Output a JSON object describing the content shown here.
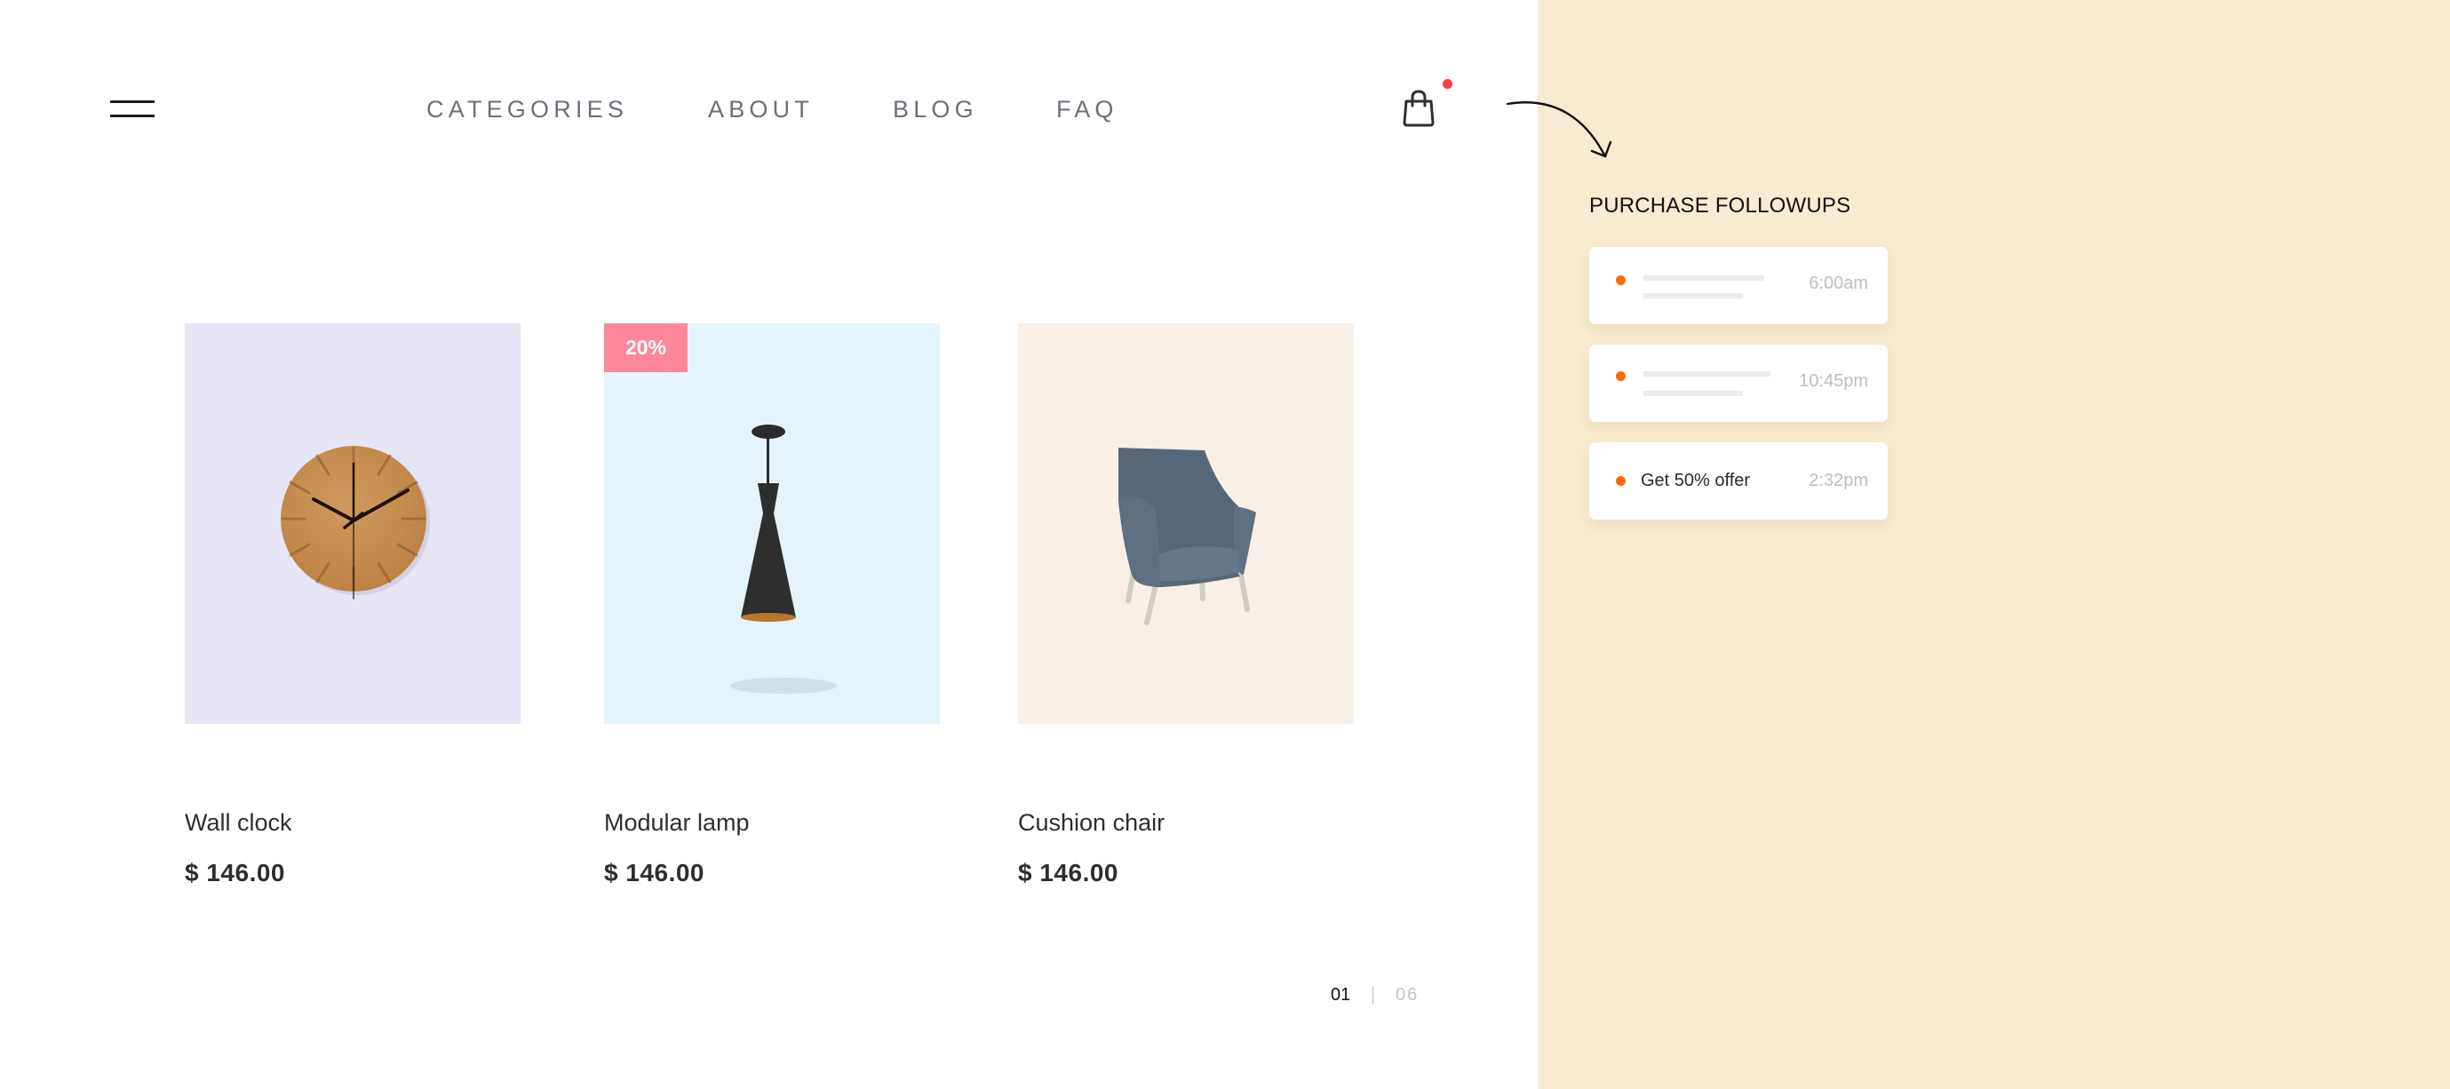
{
  "header": {
    "menu_icon": "hamburger-menu-icon",
    "nav": [
      {
        "label": "CATEGORIES"
      },
      {
        "label": "ABOUT"
      },
      {
        "label": "BLOG"
      },
      {
        "label": "FAQ"
      }
    ],
    "cart_icon": "shopping-bag-icon",
    "cart_has_notification": true,
    "notification_color": "#ff3b3b"
  },
  "products": [
    {
      "name": "Wall clock",
      "price": "$ 146.00",
      "image": "wall-clock",
      "bg_color": "#e6e5f5",
      "badge": null
    },
    {
      "name": "Modular lamp",
      "price": "$ 146.00",
      "image": "pendant-lamp",
      "bg_color": "#e5f4fa",
      "badge": "20%"
    },
    {
      "name": "Cushion chair",
      "price": "$ 146.00",
      "image": "armchair",
      "bg_color": "#f8efe6",
      "badge": null
    }
  ],
  "pagination": {
    "current": "01",
    "separator": "|",
    "total": "06"
  },
  "followups": {
    "title": "PURCHASE FOLLOWUPS",
    "accent_color": "#ff6a00",
    "items": [
      {
        "text": null,
        "time": "6:00am"
      },
      {
        "text": null,
        "time": "10:45pm"
      },
      {
        "text": "Get 50% offer",
        "time": "2:32pm"
      }
    ]
  },
  "colors": {
    "panel_bg": "#f7ebd1",
    "badge_bg": "#fd8799",
    "nav_text": "#6b7079"
  }
}
